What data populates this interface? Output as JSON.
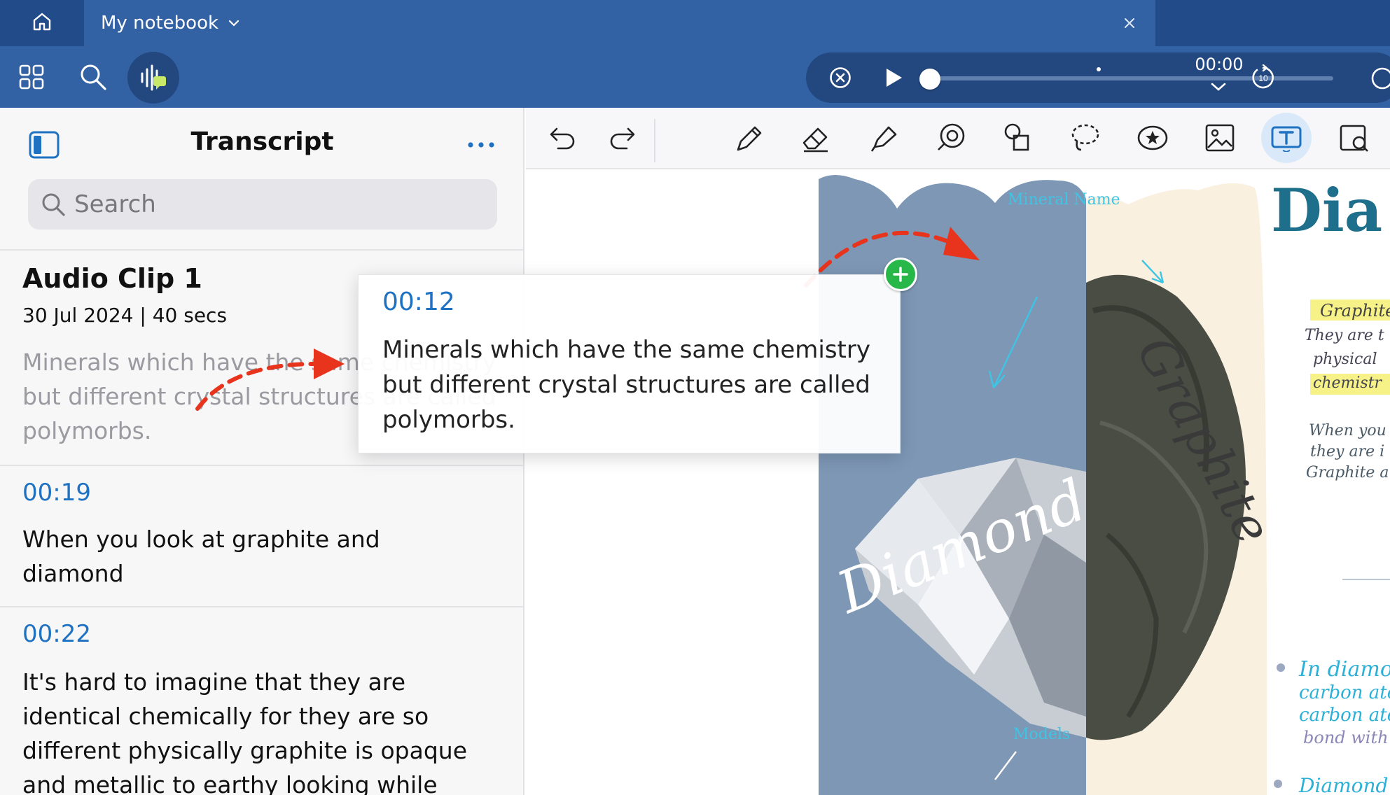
{
  "app": {
    "tab_title": "My notebook"
  },
  "player": {
    "time": "00:00",
    "progress": 0.0,
    "skip_seconds_label": "10"
  },
  "transcript": {
    "title": "Transcript",
    "search_placeholder": "Search",
    "clip": {
      "title": "Audio Clip 1",
      "meta": "30 Jul 2024 | 40 secs"
    },
    "segments": [
      {
        "time": "00:12",
        "text": "Minerals which have the same chemistry but different crystal structures are called polymorbs."
      },
      {
        "time": "00:19",
        "text": "When you look at graphite and diamond"
      },
      {
        "time": "00:22",
        "text": "It's hard to imagine that they are identical chemically for they are so different physically graphite is opaque and metallic to earthy looking while"
      }
    ]
  },
  "drag_preview": {
    "time": "00:12",
    "text": "Minerals which have the same chemistry but different crystal structures are called polymorbs."
  },
  "notebook_page": {
    "title_fragment": "Dia",
    "labels": {
      "diamond": "Diamond",
      "graphite": "Graphite",
      "mineral_name": "Mineral Name",
      "models": "Models"
    },
    "notes_top": [
      "Graphite",
      "They are t",
      "physical",
      "chemistr"
    ],
    "notes_mid": [
      "When you",
      "they are i",
      "Graphite a"
    ],
    "notes_bottom": [
      "In diamond",
      "carbon ato",
      "carbon ato",
      "bond with f",
      "Diamond is"
    ]
  },
  "colors": {
    "header_dark": "#224c89",
    "header": "#3262a4",
    "accent_blue": "#1f72c2",
    "arrow_red": "#e8341c",
    "add_green": "#28b84a"
  }
}
